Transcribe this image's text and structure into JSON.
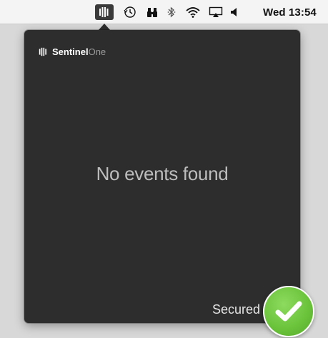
{
  "menubar": {
    "status_icons": [
      "sentinelone-icon",
      "time-machine-icon",
      "binoculars-icon",
      "bluetooth-icon",
      "wifi-icon",
      "airplay-icon",
      "volume-icon"
    ],
    "clock": "Wed 13:54"
  },
  "panel": {
    "brand": {
      "name_bold": "Sentinel",
      "name_light": "One",
      "icon": "sentinelone-icon"
    },
    "empty_message": "No events found",
    "status": {
      "label": "Secured",
      "icon": "checkmark-icon",
      "color": "#6cc43c"
    }
  }
}
